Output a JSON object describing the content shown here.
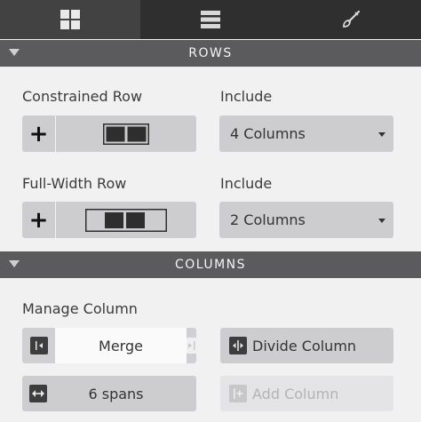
{
  "tabs": [
    {
      "name": "layout-grid-icon",
      "active": true
    },
    {
      "name": "list-icon",
      "active": false
    },
    {
      "name": "brush-icon",
      "active": false
    }
  ],
  "rows_section": {
    "title": "ROWS",
    "constrained_label": "Constrained Row",
    "include_label_1": "Include",
    "constrained_select": "4 Columns",
    "fullwidth_label": "Full-Width Row",
    "include_label_2": "Include",
    "fullwidth_select": "2 Columns",
    "plus_glyph": "+"
  },
  "columns_section": {
    "title": "COLUMNS",
    "manage_label": "Manage Column",
    "merge_label": "Merge",
    "divide_label": "Divide Column",
    "spans_label": "6 spans",
    "add_column_label": "Add Column"
  },
  "colors": {
    "tab_bar": "#2f2f2f",
    "tab_active": "#424242",
    "section_header": "#5b5b5d",
    "panel_bg": "#f1f1f2",
    "button_bg": "#cdcdcf",
    "disabled_bg": "#e4e4e6"
  }
}
